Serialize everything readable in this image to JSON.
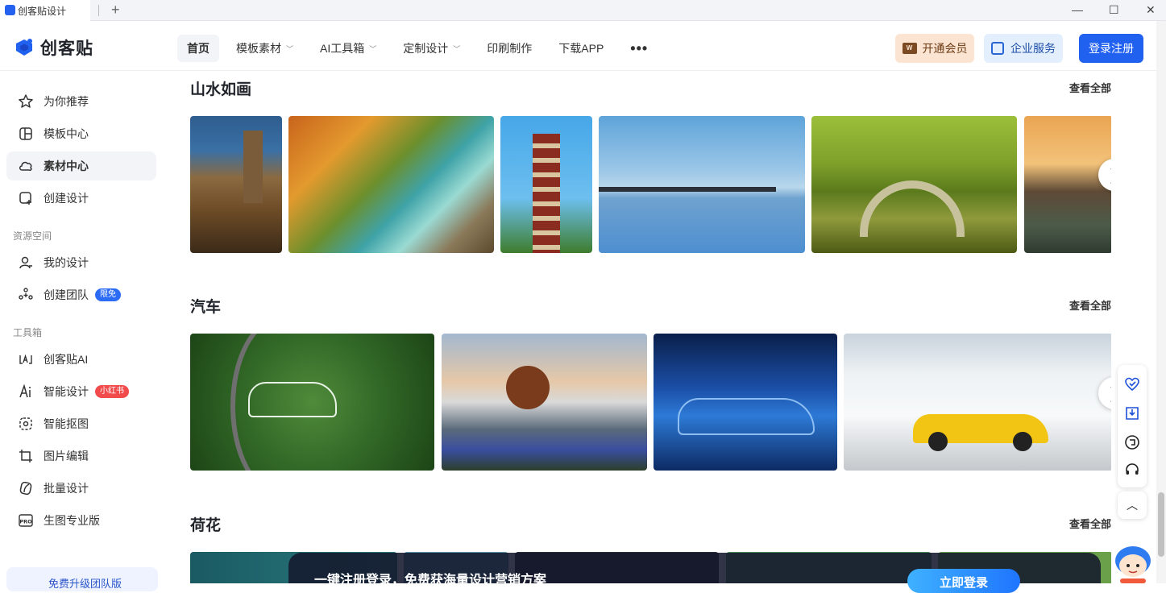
{
  "window": {
    "tab_title": "创客贴设计",
    "new_tab": "+",
    "minimize": "—",
    "maximize": "☐",
    "close": "✕"
  },
  "header": {
    "logo_text": "创客贴",
    "nav": [
      {
        "label": "首页",
        "active": true
      },
      {
        "label": "模板素材",
        "dropdown": true
      },
      {
        "label": "AI工具箱",
        "dropdown": true
      },
      {
        "label": "定制设计",
        "dropdown": true
      },
      {
        "label": "印刷制作"
      },
      {
        "label": "下载APP"
      }
    ],
    "more": "•••",
    "vip_icon": "W",
    "vip_label": "开通会员",
    "enterprise_label": "企业服务",
    "login_label": "登录注册"
  },
  "sidebar": {
    "items": [
      {
        "label": "为你推荐",
        "icon": "star-icon"
      },
      {
        "label": "模板中心",
        "icon": "template-icon"
      },
      {
        "label": "素材中心",
        "icon": "material-icon",
        "active": true
      },
      {
        "label": "创建设计",
        "icon": "create-icon"
      }
    ],
    "group_resources": "资源空间",
    "resource_items": [
      {
        "label": "我的设计",
        "icon": "user-icon"
      },
      {
        "label": "创建团队",
        "icon": "team-icon",
        "badge": "限免"
      }
    ],
    "group_tools": "工具箱",
    "tool_items": [
      {
        "label": "创客贴AI",
        "icon": "ai-icon"
      },
      {
        "label": "智能设计",
        "icon": "smart-design-icon",
        "badge": "小红书"
      },
      {
        "label": "智能抠图",
        "icon": "cutout-icon"
      },
      {
        "label": "图片编辑",
        "icon": "crop-icon"
      },
      {
        "label": "批量设计",
        "icon": "batch-icon"
      },
      {
        "label": "生图专业版",
        "icon": "pro-icon"
      }
    ],
    "upgrade_label": "免费升级团队版"
  },
  "sections": [
    {
      "title": "山水如画",
      "view_all": "查看全部"
    },
    {
      "title": "汽车",
      "view_all": "查看全部"
    },
    {
      "title": "荷花",
      "view_all": "查看全部"
    }
  ],
  "banner": {
    "text": "一键注册登录，免费获海量设计营销方案",
    "button": "立即登录"
  },
  "colors": {
    "brand_blue": "#2161f0",
    "vip_bg": "#fbe5d2",
    "enterprise_bg": "#e3effd"
  }
}
